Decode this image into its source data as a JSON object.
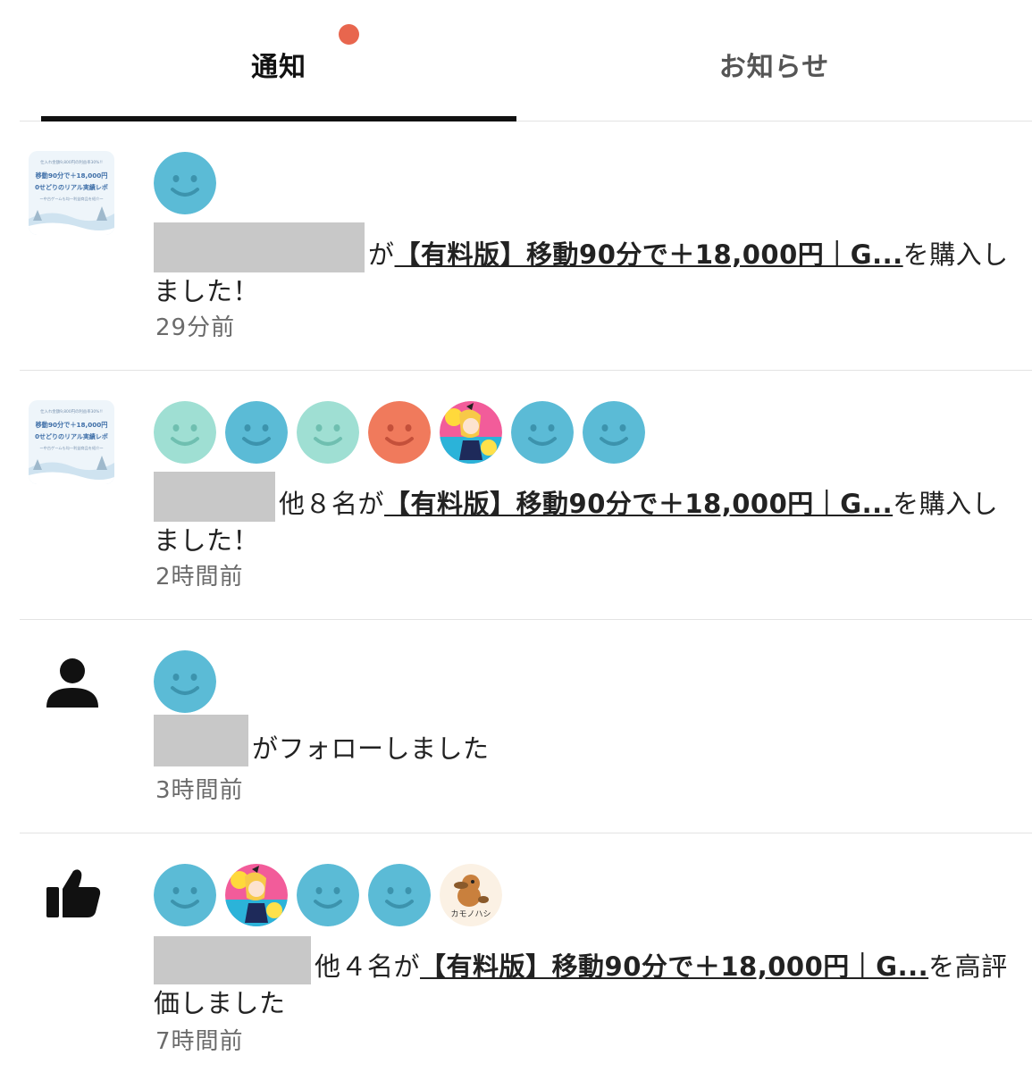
{
  "tabs": {
    "notifications_label": "通知",
    "announcements_label": "お知らせ"
  },
  "article_thumb": {
    "line1": "仕入れ金額9,800円の利益率30%!!",
    "line2": "移動90分で＋18,000円",
    "line3": "0せどりのリアル実績レポ",
    "line4": "〜中古ゲームも均一利益商品を紹介〜"
  },
  "notifications": [
    {
      "type": "purchase",
      "lead_icon": "article-thumbnail",
      "avatar_count": 1,
      "actor_suffix": "が",
      "article_link": "【有料版】移動90分で＋18,000円｜G...",
      "action": "を購入しました！",
      "time": "29分前"
    },
    {
      "type": "purchase",
      "lead_icon": "article-thumbnail",
      "avatar_count": 7,
      "actor_suffix": "他８名が",
      "article_link": "【有料版】移動90分で＋18,000円｜G...",
      "action": "を購入しました！",
      "time": "2時間前"
    },
    {
      "type": "follow",
      "lead_icon": "person-icon",
      "avatar_count": 1,
      "actor_suffix": "",
      "article_link": "",
      "action": "がフォローしました",
      "time": "3時間前"
    },
    {
      "type": "like",
      "lead_icon": "thumbs-up-icon",
      "avatar_count": 5,
      "actor_suffix": "他４名が",
      "article_link": "【有料版】移動90分で＋18,000円｜G...",
      "action": "を高評価しました",
      "time": "7時間前"
    }
  ],
  "platypus_avatar_label": "カモノハシ",
  "colors": {
    "smiley_blue": "#5bbbd6",
    "smiley_mint": "#9fdfd3",
    "smiley_orange": "#f07a5c",
    "badge_red": "#e8664e",
    "redaction_gray": "#c8c8c8"
  }
}
